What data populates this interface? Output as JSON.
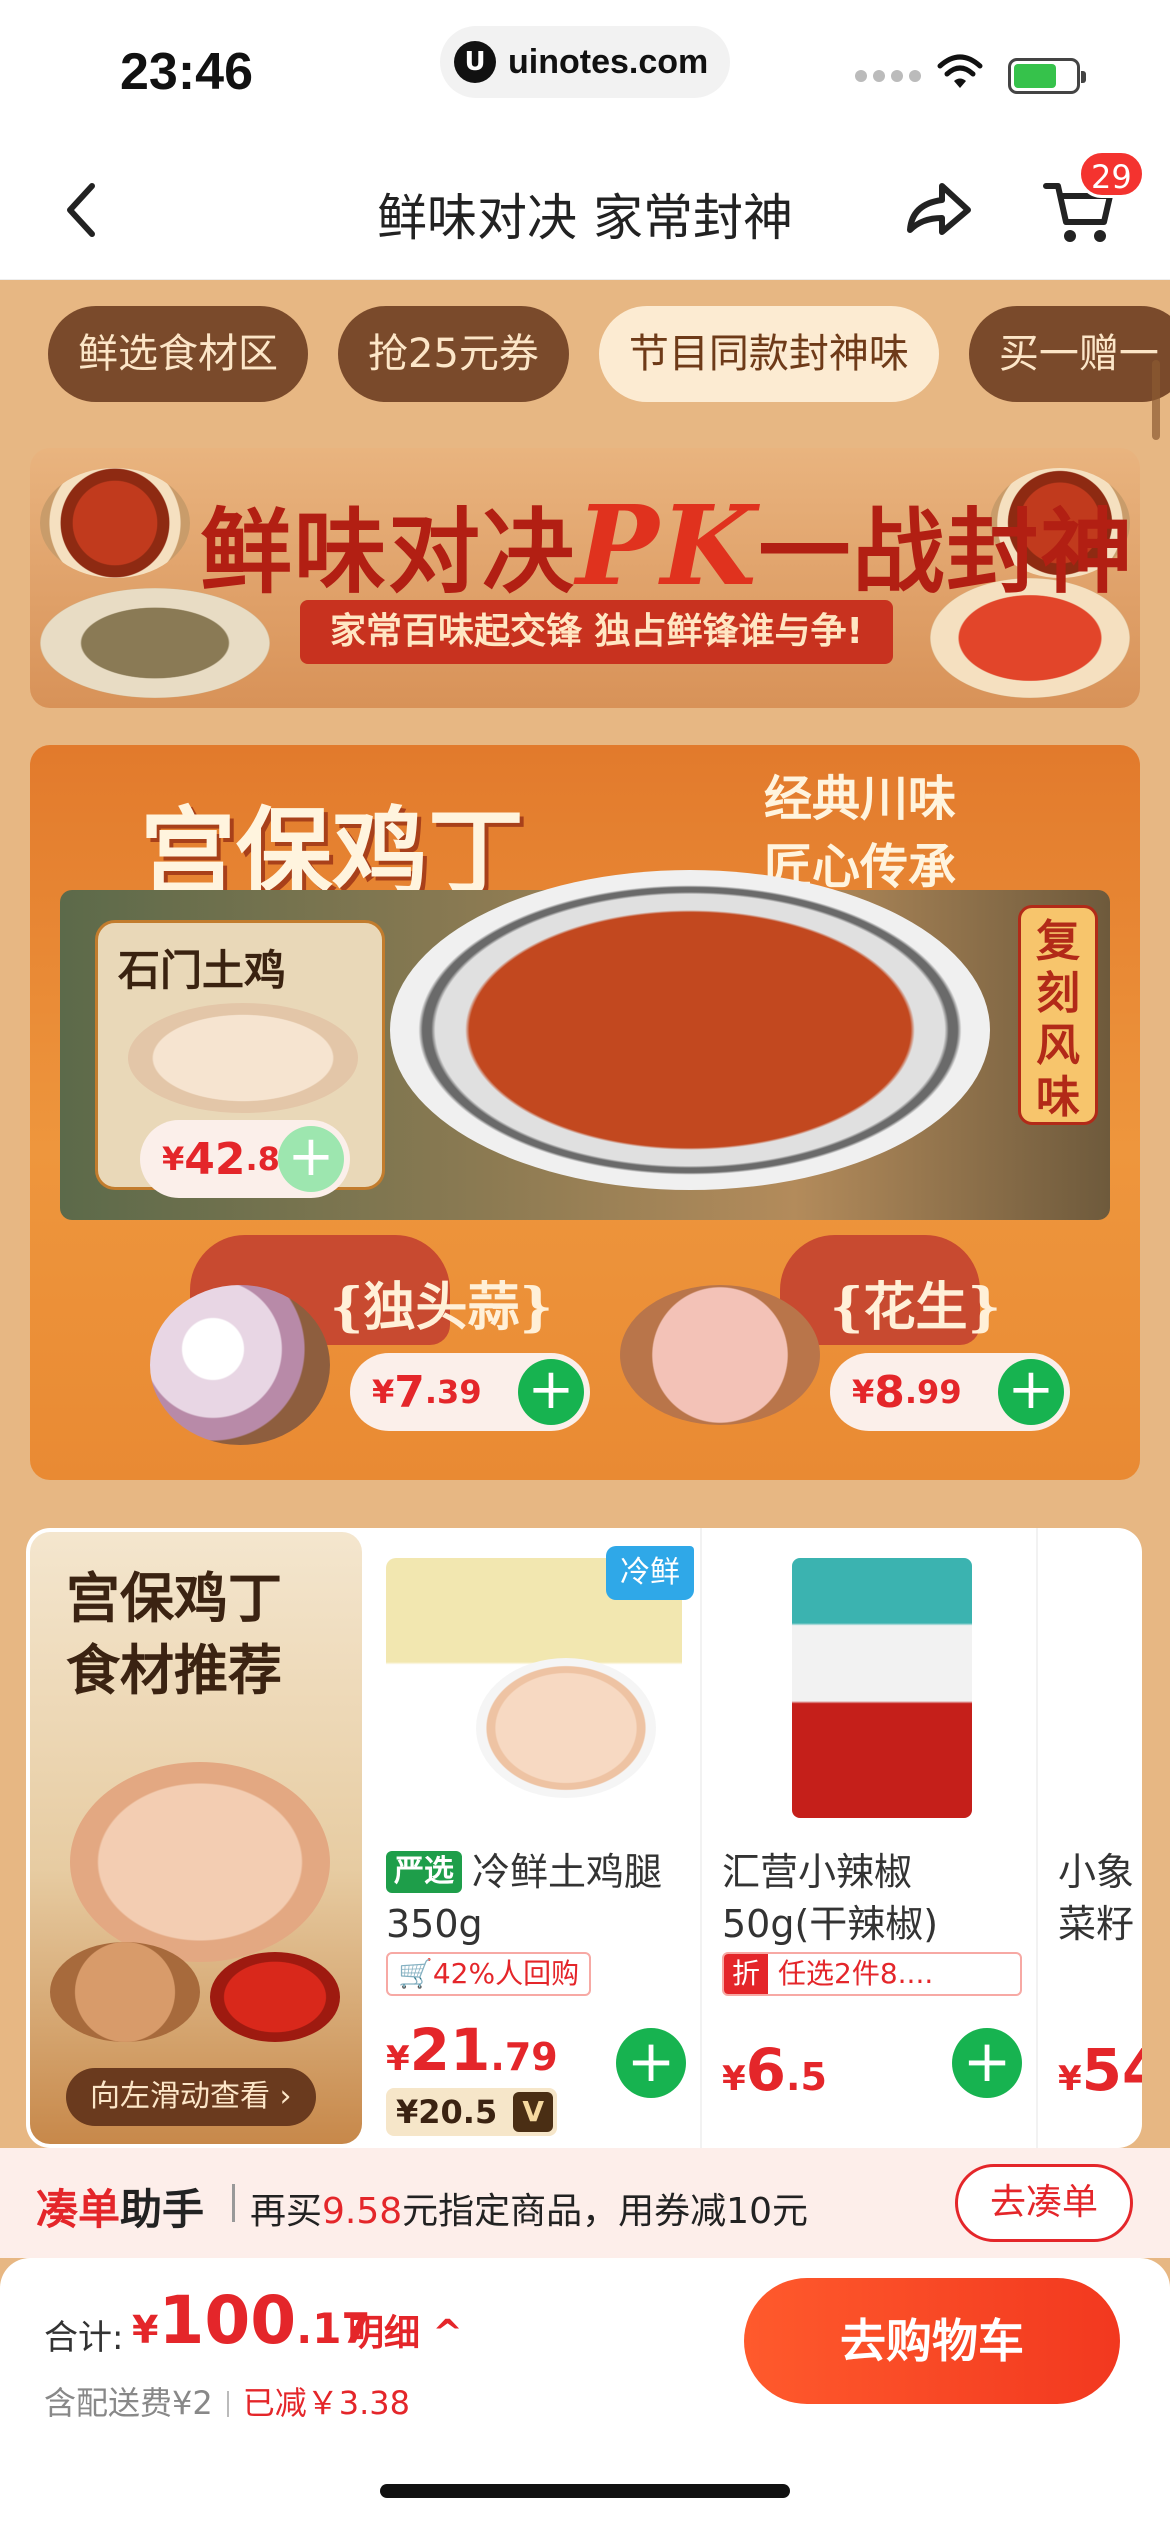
{
  "status": {
    "time": "23:46",
    "url": "uinotes.com"
  },
  "nav": {
    "title": "鲜味对决 家常封神",
    "cart_count": "29"
  },
  "tabs": [
    {
      "label": "鲜选食材区",
      "active": false
    },
    {
      "label": "抢25元券",
      "active": false
    },
    {
      "label": "节目同款封神味",
      "active": true
    },
    {
      "label": "买一赠一",
      "active": false
    }
  ],
  "hero": {
    "title_a": "鲜味对决",
    "title_pk": "PK",
    "title_b": "一战封神",
    "subtitle": "家常百味起交锋 独占鲜锋谁与争!"
  },
  "kungpao": {
    "title": "宫保鸡丁",
    "slogan_line1": "经典川味",
    "slogan_line2": "匠心传承",
    "badge": "复刻风味",
    "chicken": {
      "label": "石门土鸡",
      "yen": "¥",
      "price_int": "42",
      "price_dec": ".8"
    },
    "garlic": {
      "label": "{独头蒜}",
      "yen": "¥",
      "price_int": "7",
      "price_dec": ".39"
    },
    "peanut": {
      "label": "{花生}",
      "yen": "¥",
      "price_int": "8",
      "price_dec": ".99"
    }
  },
  "products": {
    "promo": {
      "title_line1": "宫保鸡丁",
      "title_line2": "食材推荐",
      "swipe": "向左滑动查看 ›"
    },
    "items": [
      {
        "tag_cold": "冷鲜",
        "brand": "严选",
        "name": "冷鲜土鸡腿350g",
        "badge": "🛒42%人回购",
        "yen": "¥",
        "price_int": "21",
        "price_dec": ".79",
        "vip_price": "¥20.5",
        "vip_mark": "V"
      },
      {
        "name": "汇营小辣椒50g(干辣椒)",
        "discount_mark": "折",
        "badge": "任选2件8....",
        "yen": "¥",
        "price_int": "6",
        "price_dec": ".5"
      },
      {
        "name": "小象菜籽",
        "yen": "¥",
        "price_int": "54",
        "price_dec": ""
      }
    ]
  },
  "helper": {
    "title_red": "凑单",
    "title_black": "助手",
    "text_a": "再买",
    "text_amount": "9.58",
    "text_b": "元指定商品，用券减10元",
    "button": "去凑单"
  },
  "bottom": {
    "total_label": "合计:",
    "total_yen": "¥",
    "total_int": "100",
    "total_dec": ".17",
    "detail": "明细 ^",
    "fee": "含配送费¥2",
    "saved": "已减￥3.38",
    "checkout": "去购物车"
  },
  "colors": {
    "accent_red": "#E4262A",
    "add_green": "#17B350",
    "tab_brown": "#7A4A2B",
    "page_bg": "#E7B783"
  }
}
